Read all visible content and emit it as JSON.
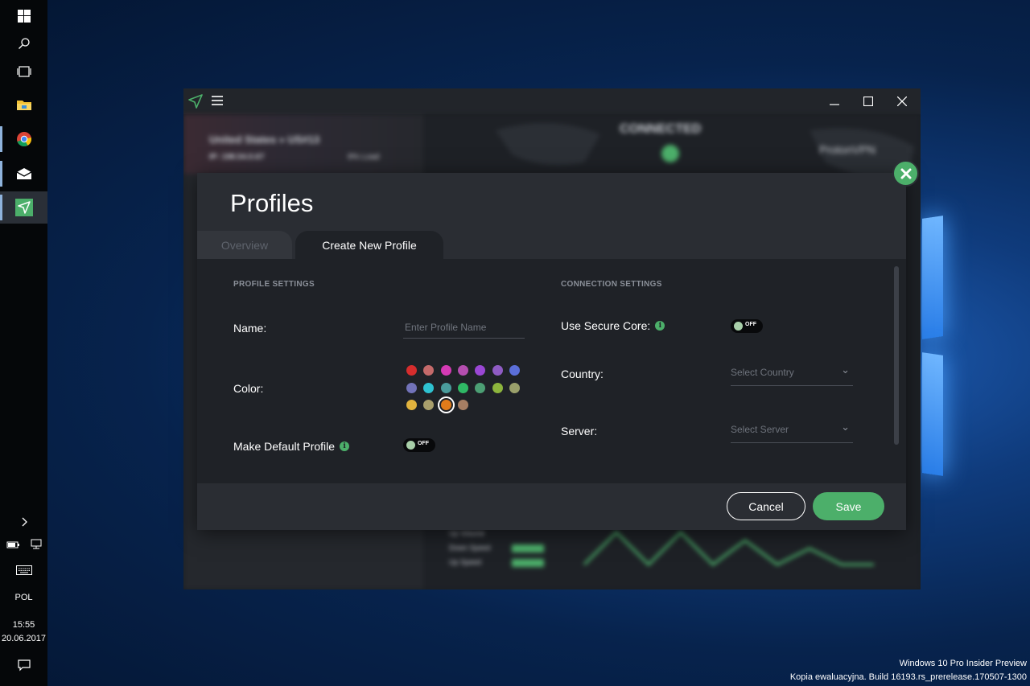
{
  "os": {
    "language": "POL",
    "time": "15:55",
    "date": "20.06.2017",
    "watermark_line1": "Windows 10 Pro Insider Preview",
    "watermark_line2": "Kopia ewaluacyjna. Build 16193.rs_prerelease.170507-1300"
  },
  "taskbar": {
    "icons": [
      "windows-start-icon",
      "search-icon",
      "task-view-icon",
      "file-explorer-icon",
      "chrome-icon",
      "mail-icon",
      "protonvpn-icon"
    ],
    "tray": [
      "chevron-right-icon",
      "battery-icon",
      "network-icon",
      "keyboard-icon",
      "notification-icon"
    ]
  },
  "app": {
    "name": "ProtonVPN",
    "background": {
      "status": "CONNECTED",
      "server": "United States » US#13",
      "ip": "IP: 198.54.0.67",
      "load_label": "9% Load",
      "brand": "ProtonVPN",
      "stats": [
        "Up Volume",
        "Down Speed",
        "Up Speed"
      ]
    }
  },
  "modal": {
    "title": "Profiles",
    "tabs": [
      {
        "label": "Overview",
        "active": false
      },
      {
        "label": "Create New Profile",
        "active": true
      }
    ],
    "profile_settings": {
      "heading": "PROFILE SETTINGS",
      "name_label": "Name:",
      "name_placeholder": "Enter Profile Name",
      "name_value": "",
      "color_label": "Color:",
      "colors": [
        "#d62d2d",
        "#c46a6a",
        "#d43ab4",
        "#b54eb0",
        "#9a47d4",
        "#8f5cc4",
        "#5b6fd9",
        "#7273b9",
        "#2ec2d1",
        "#4a9c9c",
        "#2fb865",
        "#4c9f74",
        "#8db53d",
        "#9aa06b",
        "#e2b33e",
        "#a99f6c",
        "#e07b1a",
        "#a67e63"
      ],
      "selected_color_index": 16,
      "default_label": "Make Default Profile",
      "default_toggle": "OFF"
    },
    "connection_settings": {
      "heading": "CONNECTION SETTINGS",
      "secure_core_label": "Use Secure Core:",
      "secure_core_toggle": "OFF",
      "country_label": "Country:",
      "country_placeholder": "Select Country",
      "server_label": "Server:",
      "server_placeholder": "Select Server"
    },
    "footer": {
      "cancel_label": "Cancel",
      "save_label": "Save"
    }
  },
  "colors": {
    "accent": "#4caf6a",
    "modal_bg": "#2a2d33",
    "body_bg": "#1f2227"
  }
}
